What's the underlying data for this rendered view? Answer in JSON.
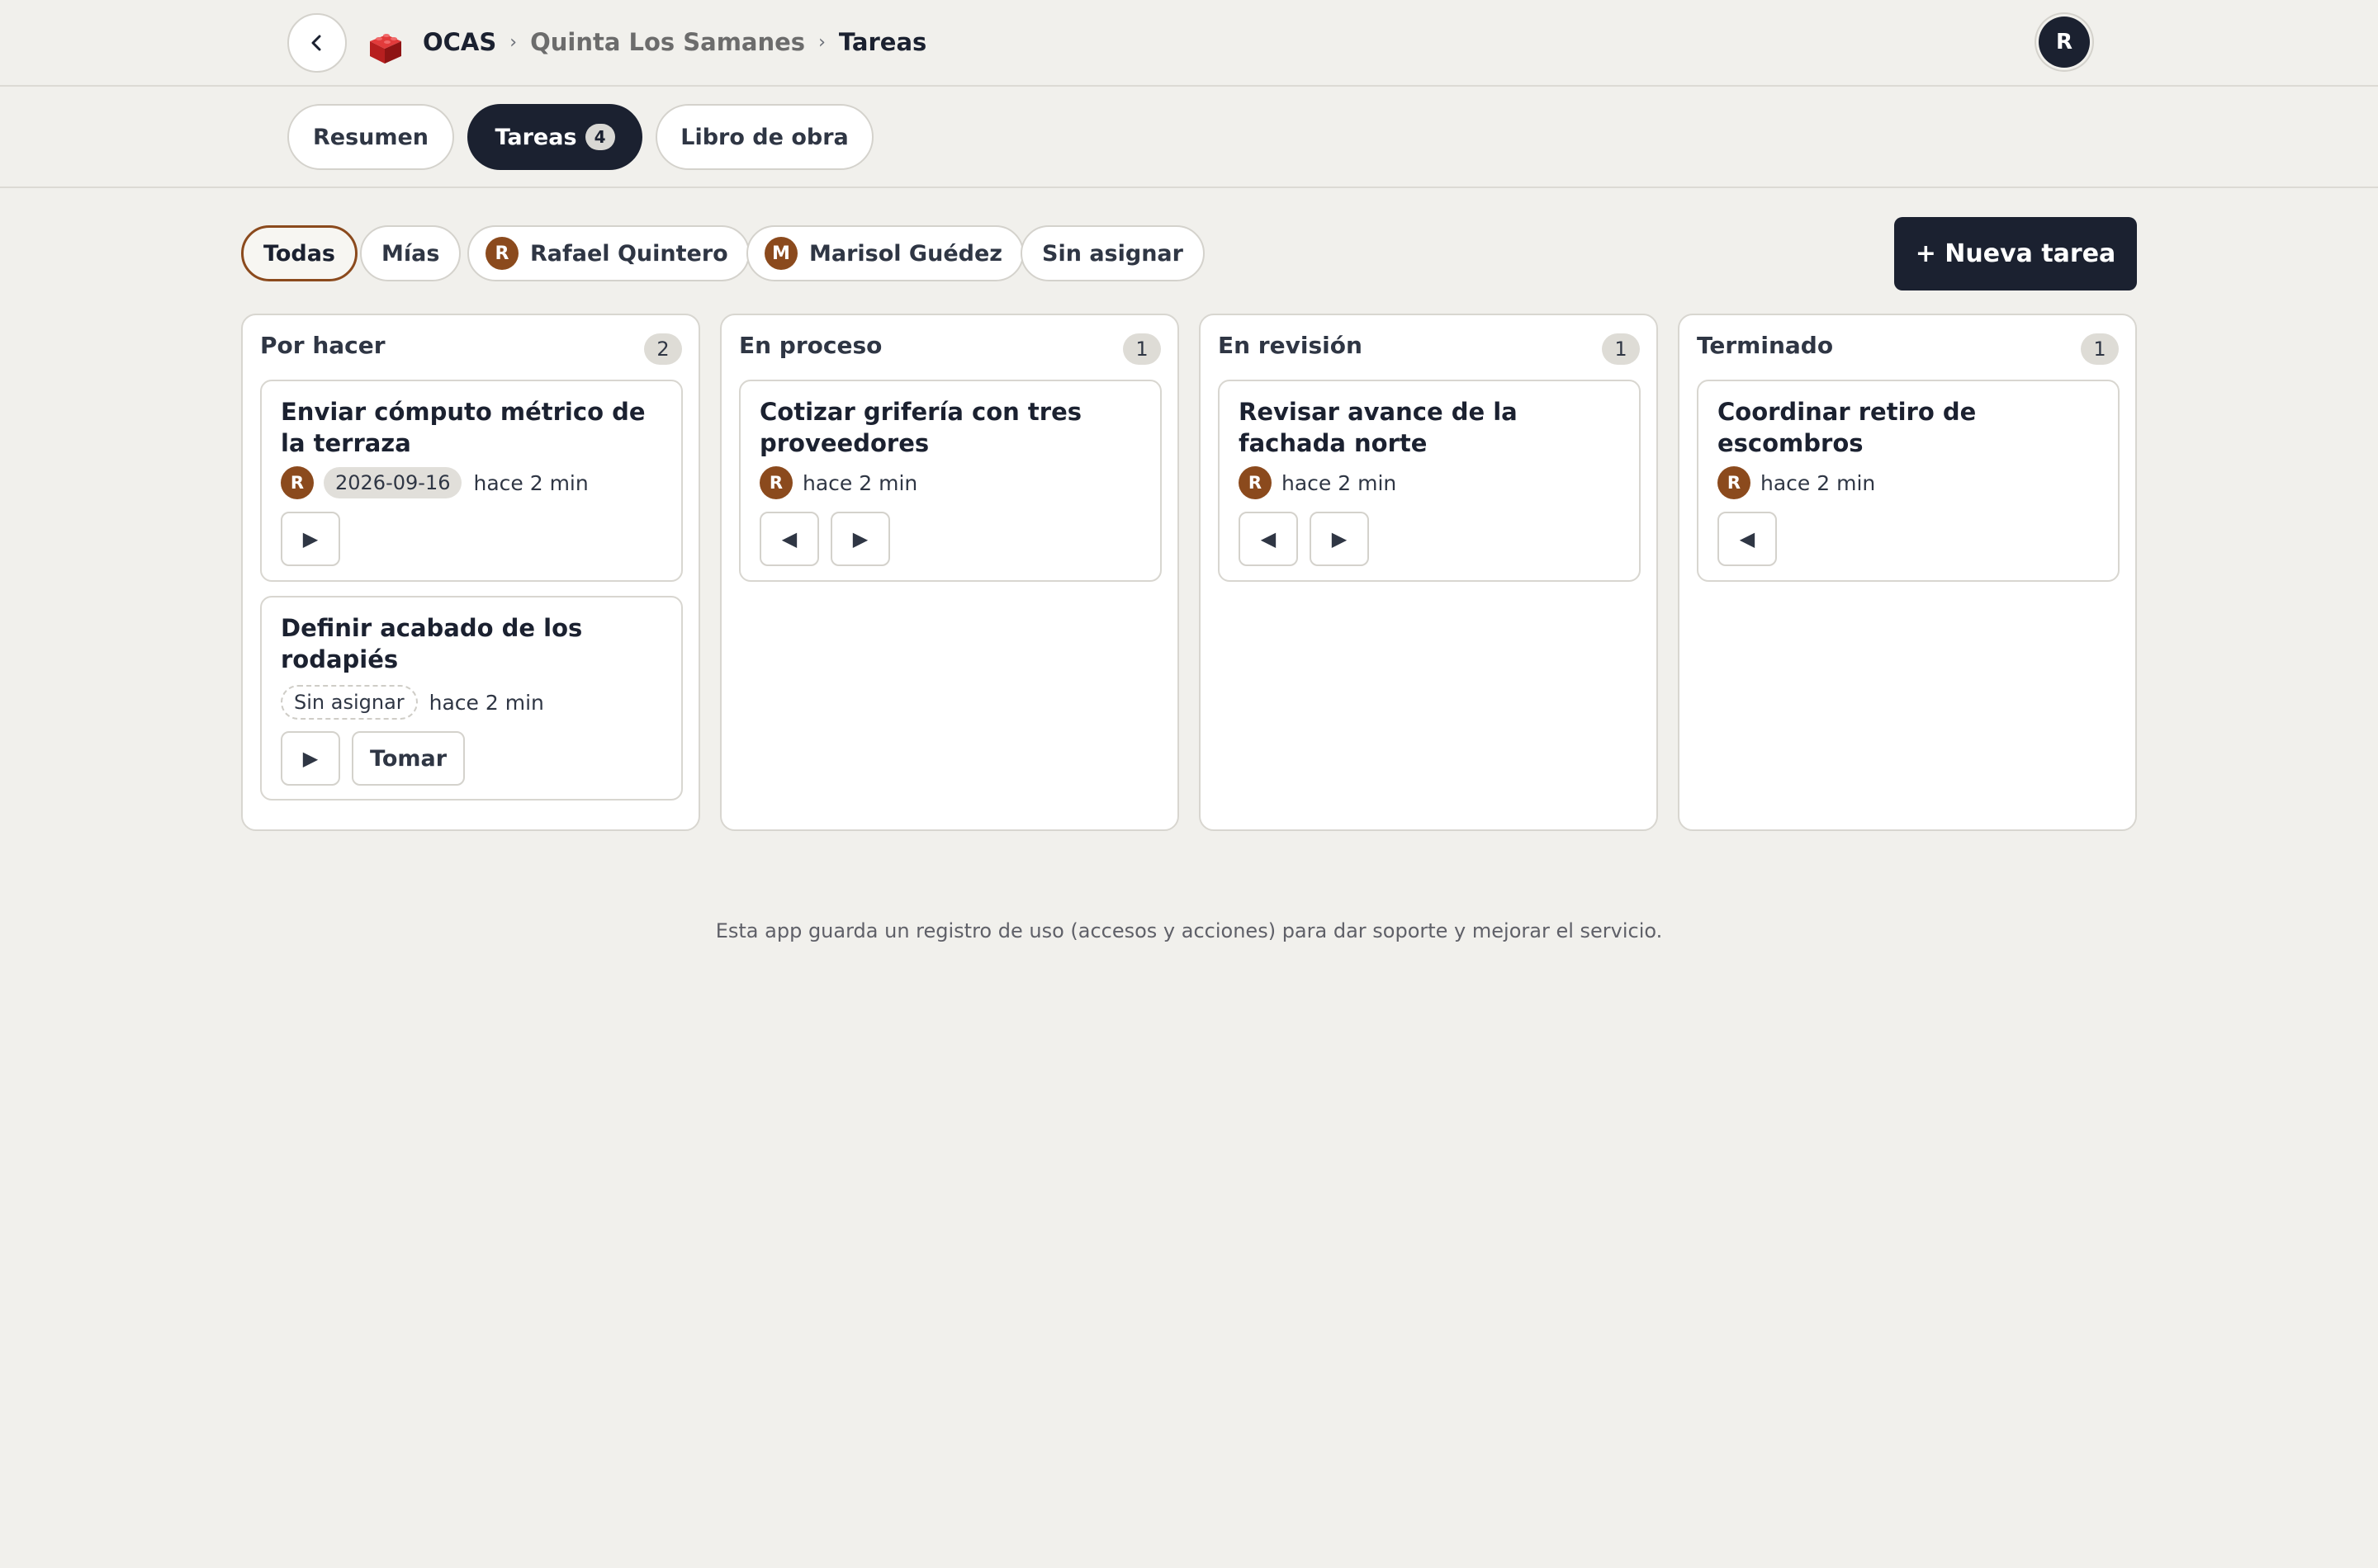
{
  "header": {
    "back_icon": "chevron-left-icon",
    "logo_icon": "red-brick-logo",
    "app_name": "OCAS",
    "breadcrumb_sep": "›",
    "project": "Quinta Los Samanes",
    "current": "Tareas",
    "user_initial": "R"
  },
  "tabs": [
    {
      "label": "Resumen"
    },
    {
      "label": "Tareas",
      "count": "4",
      "active": true
    },
    {
      "label": "Libro de obra"
    }
  ],
  "filters": {
    "all": "Todas",
    "mine": "Mías",
    "user1": {
      "initial": "R",
      "name": "Rafael Quintero"
    },
    "user2": {
      "initial": "M",
      "name": "Marisol Guédez"
    },
    "unassigned": "Sin asignar"
  },
  "new_task_label": "+ Nueva tarea",
  "columns": [
    {
      "title": "Por hacer",
      "count": "2",
      "cards": [
        {
          "title": "Enviar cómputo métrico de la terraza",
          "assignee": "R",
          "due": "2026-09-16",
          "time": "hace 2 min",
          "next": "▶"
        },
        {
          "title": "Definir acabado de los rodapiés",
          "assignee_label": "Sin asignar",
          "time": "hace 2 min",
          "next": "▶",
          "take": "Tomar"
        }
      ]
    },
    {
      "title": "En proceso",
      "count": "1",
      "cards": [
        {
          "title": "Cotizar grifería con tres proveedores",
          "assignee": "R",
          "time": "hace 2 min",
          "prev": "◀",
          "next": "▶"
        }
      ]
    },
    {
      "title": "En revisión",
      "count": "1",
      "cards": [
        {
          "title": "Revisar avance de la fachada norte",
          "assignee": "R",
          "time": "hace 2 min",
          "prev": "◀",
          "next": "▶"
        }
      ]
    },
    {
      "title": "Terminado",
      "count": "1",
      "cards": [
        {
          "title": "Coordinar retiro de escombros",
          "assignee": "R",
          "time": "hace 2 min",
          "prev": "◀"
        }
      ]
    }
  ],
  "footer_note": "Esta app guarda un registro de uso (accesos y acciones) para dar soporte y mejorar el servicio.",
  "colors": {
    "primary": "#1b2130",
    "avatar": "#8b4a1d",
    "background": "#f1f0ec",
    "logo": "#d42a2a"
  }
}
